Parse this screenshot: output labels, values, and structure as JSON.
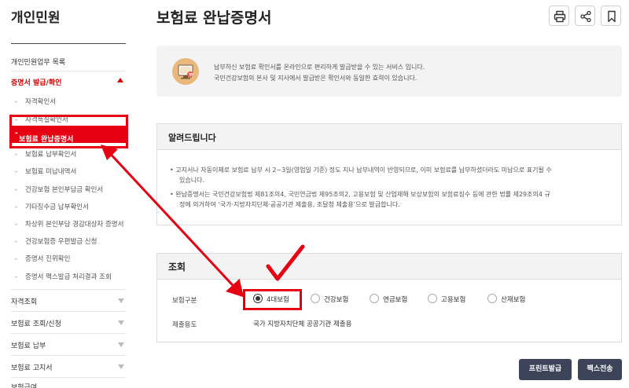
{
  "sidebar": {
    "title": "개인민원",
    "top_item": "개인민원업무 목록",
    "section_open": "증명서 발급/확인",
    "sub_items": [
      "자격확인서",
      "자격득실확인서",
      "보험료 완납증명서",
      "보험료 납부확인서",
      "보험료 미납내역서",
      "건강보험 본인부담금 확인서",
      "기타징수금 납부확인서",
      "차상위 본인부담 경감대상자 증명서",
      "건강보험증 우편발급 신청",
      "증명서 진위확인",
      "증명서 팩스발급 처리결과 조회"
    ],
    "collapsed_sections": [
      "자격조회",
      "보험료 조회/신청",
      "보험료 납부",
      "보험료 고지서",
      "보험급여"
    ]
  },
  "main": {
    "title": "보험료 완납증명서",
    "icons": [
      "printer-icon",
      "share-icon",
      "bookmark-icon"
    ],
    "info_lines": [
      "납부하신 보험료 확인서를 온라인으로 편리하게 발급받을 수 있는 서비스 입니다.",
      "국민건강보험의 본사 및 지사에서 발급받은 확인서와 동일한 효력이 있습니다."
    ],
    "notice": {
      "title": "알려드립니다",
      "lines": [
        "• 고지서나 자동이체로 보험료 납부 시 2~3일(영업일 기준) 정도 지나 납부내역이 반영되므로, 이미 보험료를 납부하셨더라도 미납으로 표기될 수",
        "있습니다.",
        "• 완납증명서는 국민건강보험법 제81조의4, 국민연금법 제95조의2, 고용보험 및 산업재해 보상보험의 보험료징수 등에 관한 법률 제29조의4 규",
        "정에 의거하여 ‘국가·지방자치단체·공공기관 제출용, 조달청 제출용’으로 발급합니다."
      ]
    },
    "query": {
      "title": "조회",
      "insurance_label": "보험구분",
      "options": [
        "4대보험",
        "건강보험",
        "연금보험",
        "고용보험",
        "산재보험"
      ],
      "selected_option": "4대보험",
      "purpose_label": "제출용도",
      "purpose_value": "국가 지방자치단체 공공기관 제출용"
    },
    "buttons": {
      "print": "프린트발급",
      "fax": "팩스전송"
    }
  },
  "colors": {
    "accent_red": "#e60012",
    "button_dark": "#3d4459"
  }
}
